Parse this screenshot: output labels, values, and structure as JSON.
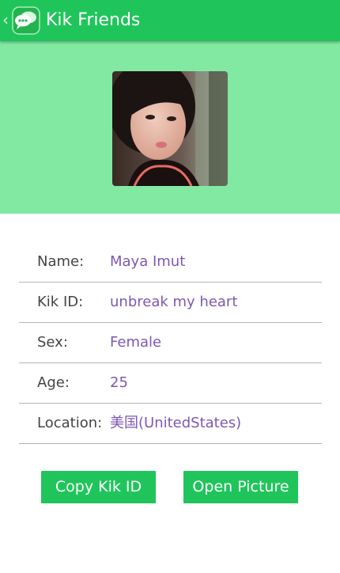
{
  "action_bar": {
    "up_caret": "‹",
    "app_icon": "kik-chat-bubble-icon",
    "title": "Kik Friends"
  },
  "profile": {
    "photo": "profile-photo"
  },
  "details": [
    {
      "label": "Name:",
      "value": "Maya Imut"
    },
    {
      "label": "Kik ID:",
      "value": "unbreak my heart"
    },
    {
      "label": "Sex:",
      "value": "Female"
    },
    {
      "label": "Age:",
      "value": "25"
    },
    {
      "label": "Location:",
      "value": "美国(UnitedStates)"
    }
  ],
  "buttons": {
    "copy_label": "Copy Kik ID",
    "open_label": "Open Picture"
  },
  "colors": {
    "action_bar": "#1fc55a",
    "hero_background": "#82e9a3",
    "value_text": "#7e57b4",
    "button": "#1fc55a"
  }
}
